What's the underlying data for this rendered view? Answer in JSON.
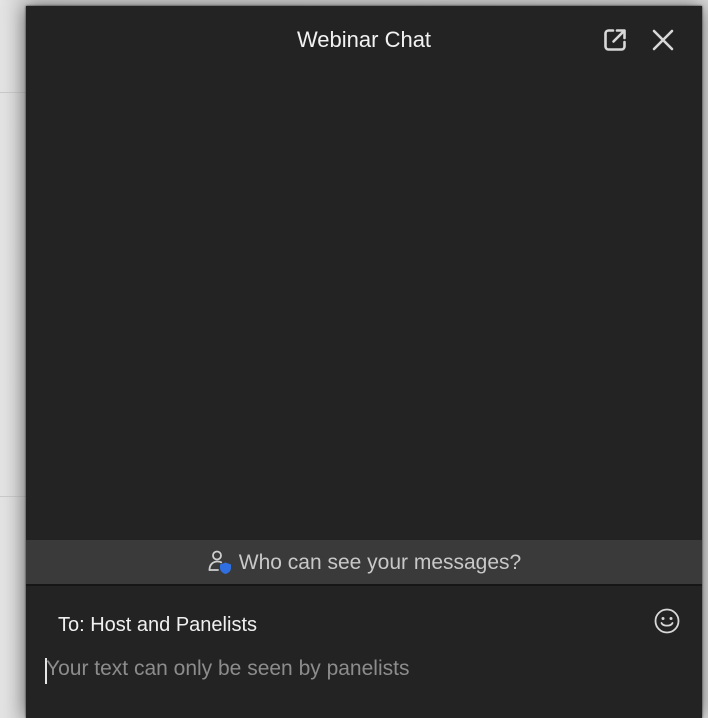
{
  "window": {
    "title": "Webinar Chat"
  },
  "icons": {
    "popout": "popout-icon",
    "close": "close-icon",
    "visibility": "person-shield-icon",
    "emoji": "emoji-smile-icon"
  },
  "visibility_notice": {
    "label": "Who can see your messages?"
  },
  "compose": {
    "recipient_label": "To: Host and Panelists",
    "input_value": "",
    "input_placeholder": "Your text can only be seen by panelists"
  },
  "colors": {
    "panel_background": "#232323",
    "notice_background": "#3a3a3a",
    "shield_accent": "#2f6fe0",
    "text_primary": "#f2f2f2",
    "text_secondary": "#c8c8c8",
    "placeholder": "#8c8c8c"
  }
}
